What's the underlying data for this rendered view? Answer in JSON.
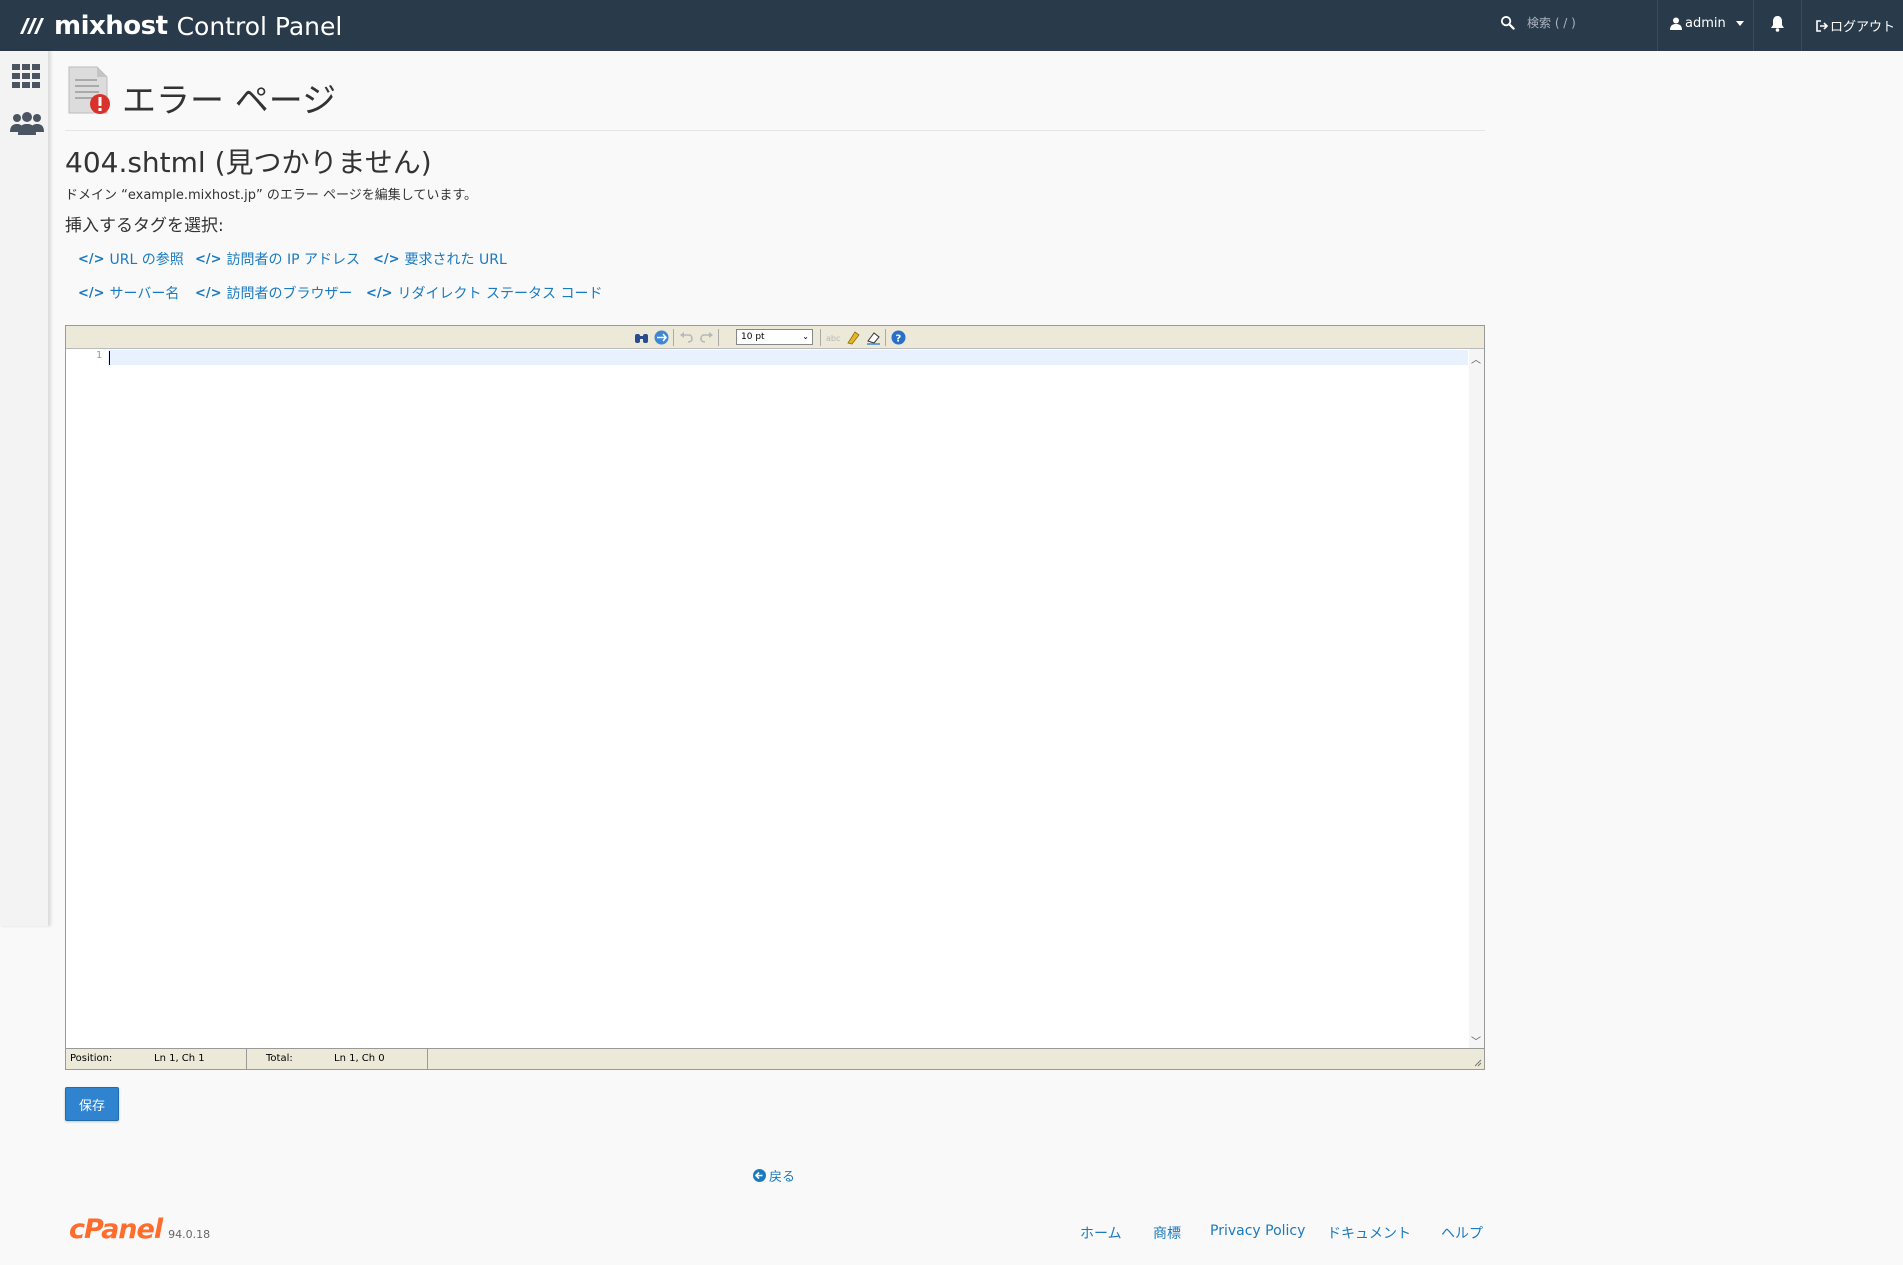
{
  "header": {
    "brand_name": "mixhost",
    "brand_sub": "Control Panel",
    "search_placeholder": "検索 ( / )",
    "user": "admin",
    "logout": "ログアウト"
  },
  "page": {
    "title": "エラー ページ",
    "subtitle": "404.shtml (見つかりません)",
    "description": "ドメイン “example.mixhost.jp” のエラー ページを編集しています。",
    "tag_label": "挿入するタグを選択:",
    "tags": [
      "URL の参照",
      "訪問者の IP アドレス",
      "要求された URL",
      "サーバー名",
      "訪問者のブラウザー",
      "リダイレクト ステータス コード"
    ]
  },
  "editor": {
    "font_size": "10 pt",
    "line_number": "1",
    "status": {
      "position_label": "Position:",
      "position_value": "Ln 1, Ch 1",
      "total_label": "Total:",
      "total_value": "Ln 1, Ch 0"
    }
  },
  "actions": {
    "save": "保存",
    "back": "戻る"
  },
  "footer": {
    "logo": "cPanel",
    "version": "94.0.18",
    "links": [
      "ホーム",
      "商標",
      "Privacy Policy",
      "ドキュメント",
      "ヘルプ"
    ]
  },
  "colors": {
    "topbar": "#293a4a",
    "link": "#1a7ac0",
    "primary_button": "#2f83cf",
    "cpanel_orange": "#ff6c2c"
  },
  "icons": [
    "mixhost-logo-icon",
    "search-icon",
    "user-icon",
    "caret-down-icon",
    "bell-icon",
    "logout-icon",
    "apps-grid-icon",
    "users-icon",
    "error-document-icon",
    "code-icon",
    "back-arrow-icon"
  ]
}
